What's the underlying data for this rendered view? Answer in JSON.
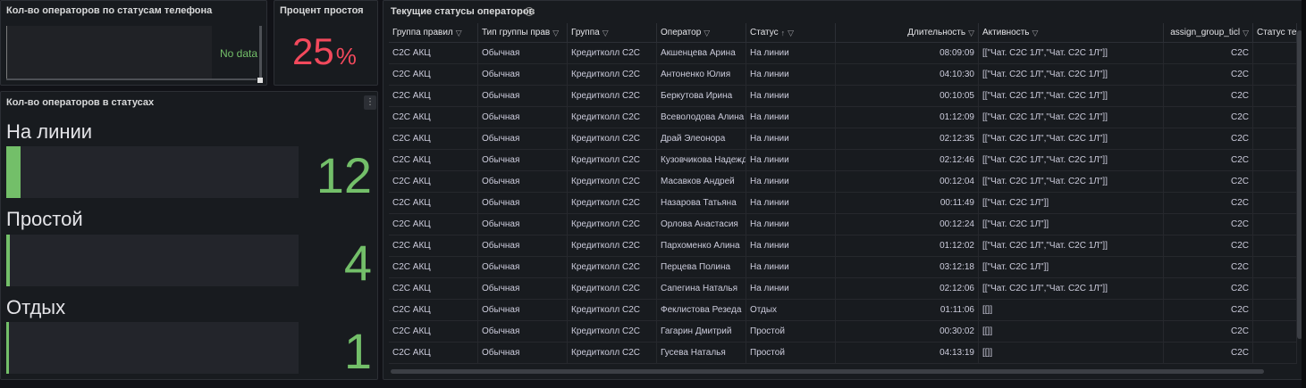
{
  "panels": {
    "phone_status": {
      "title": "Кол-во операторов по статусам телефона",
      "no_data": "No data"
    },
    "idle_percent": {
      "title": "Процент простоя",
      "value": "25",
      "unit": "%",
      "color": "#f2495c"
    },
    "operators_by_status": {
      "title": "Кол-во операторов в статусах",
      "menu_icon": "more-vertical-icon",
      "gauges": [
        {
          "label": "На линии",
          "value": "12",
          "fill": 0.05
        },
        {
          "label": "Простой",
          "value": "4",
          "fill": 0.012
        },
        {
          "label": "Отдых",
          "value": "1",
          "fill": 0.003
        }
      ],
      "color": "#73bf69"
    },
    "current_statuses": {
      "title": "Текущие статусы операторов",
      "info_icon": "info-icon",
      "columns": [
        {
          "label": "Группа правил",
          "filter": true
        },
        {
          "label": "Тип группы прав",
          "filter": true
        },
        {
          "label": "Группа",
          "filter": true
        },
        {
          "label": "Оператор",
          "filter": true
        },
        {
          "label": "Статус",
          "filter": true,
          "sort": "↑"
        },
        {
          "label": "Длительность",
          "filter": true
        },
        {
          "label": "Активность",
          "filter": true
        },
        {
          "label": "assign_group_ticl",
          "filter": true
        },
        {
          "label": "Статус теле",
          "filter": false
        }
      ],
      "rows": [
        [
          "C2C АКЦ",
          "Обычная",
          "Кредитколл C2C",
          "Акшенцева Арина",
          "На линии",
          "08:09:09",
          "[[\"Чат. C2C 1Л\",\"Чат. C2C 1Л\"]]",
          "C2C",
          ""
        ],
        [
          "C2C АКЦ",
          "Обычная",
          "Кредитколл C2C",
          "Антоненко Юлия",
          "На линии",
          "04:10:30",
          "[[\"Чат. C2C 1Л\",\"Чат. C2C 1Л\"]]",
          "C2C",
          ""
        ],
        [
          "C2C АКЦ",
          "Обычная",
          "Кредитколл C2C",
          "Беркутова Ирина",
          "На линии",
          "00:10:05",
          "[[\"Чат. C2C 1Л\",\"Чат. C2C 1Л\"]]",
          "C2C",
          ""
        ],
        [
          "C2C АКЦ",
          "Обычная",
          "Кредитколл C2C",
          "Всеволодова Алина",
          "На линии",
          "01:12:09",
          "[[\"Чат. C2C 1Л\",\"Чат. C2C 1Л\"]]",
          "C2C",
          ""
        ],
        [
          "C2C АКЦ",
          "Обычная",
          "Кредитколл C2C",
          "Драй Элеонора",
          "На линии",
          "02:12:35",
          "[[\"Чат. C2C 1Л\",\"Чат. C2C 1Л\"]]",
          "C2C",
          ""
        ],
        [
          "C2C АКЦ",
          "Обычная",
          "Кредитколл C2C",
          "Кузовчикова Надежда",
          "На линии",
          "02:12:46",
          "[[\"Чат. C2C 1Л\",\"Чат. C2C 1Л\"]]",
          "C2C",
          ""
        ],
        [
          "C2C АКЦ",
          "Обычная",
          "Кредитколл C2C",
          "Масавков Андрей",
          "На линии",
          "00:12:04",
          "[[\"Чат. C2C 1Л\",\"Чат. C2C 1Л\"]]",
          "C2C",
          ""
        ],
        [
          "C2C АКЦ",
          "Обычная",
          "Кредитколл C2C",
          "Назарова Татьяна",
          "На линии",
          "00:11:49",
          "[[\"Чат. C2C 1Л\"]]",
          "C2C",
          ""
        ],
        [
          "C2C АКЦ",
          "Обычная",
          "Кредитколл C2C",
          "Орлова Анастасия",
          "На линии",
          "00:12:24",
          "[[\"Чат. C2C 1Л\"]]",
          "C2C",
          ""
        ],
        [
          "C2C АКЦ",
          "Обычная",
          "Кредитколл C2C",
          "Пархоменко Алина",
          "На линии",
          "01:12:02",
          "[[\"Чат. C2C 1Л\",\"Чат. C2C 1Л\"]]",
          "C2C",
          ""
        ],
        [
          "C2C АКЦ",
          "Обычная",
          "Кредитколл C2C",
          "Перцева Полина",
          "На линии",
          "03:12:18",
          "[[\"Чат. C2C 1Л\"]]",
          "C2C",
          ""
        ],
        [
          "C2C АКЦ",
          "Обычная",
          "Кредитколл C2C",
          "Сапегина Наталья",
          "На линии",
          "02:12:06",
          "[[\"Чат. C2C 1Л\",\"Чат. C2C 1Л\"]]",
          "C2C",
          ""
        ],
        [
          "C2C АКЦ",
          "Обычная",
          "Кредитколл C2C",
          "Феклистова Резеда",
          "Отдых",
          "01:11:06",
          "[[]]",
          "C2C",
          ""
        ],
        [
          "C2C АКЦ",
          "Обычная",
          "Кредитколл C2C",
          "Гагарин Дмитрий",
          "Простой",
          "00:30:02",
          "[[]]",
          "C2C",
          ""
        ],
        [
          "C2C АКЦ",
          "Обычная",
          "Кредитколл C2C",
          "Гусева Наталья",
          "Простой",
          "04:13:19",
          "[[]]",
          "C2C",
          ""
        ]
      ]
    }
  }
}
